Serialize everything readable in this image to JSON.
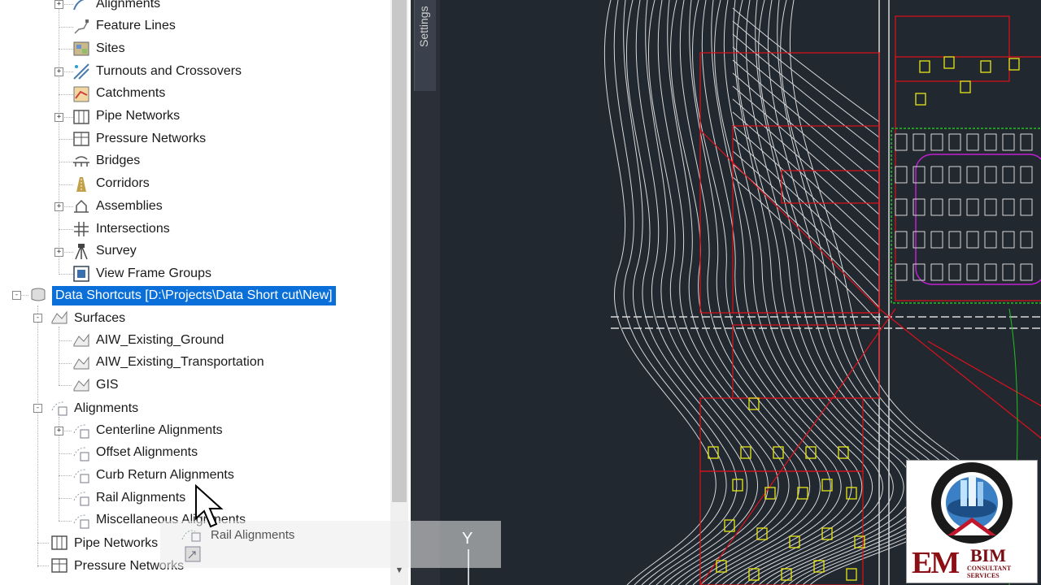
{
  "toolspace": {
    "prospector_items": [
      {
        "label": "Alignments",
        "icon": "alignments-icon",
        "expandable": true
      },
      {
        "label": "Feature Lines",
        "icon": "feature-lines-icon",
        "expandable": false
      },
      {
        "label": "Sites",
        "icon": "sites-icon",
        "expandable": false
      },
      {
        "label": "Turnouts and Crossovers",
        "icon": "turnouts-icon",
        "expandable": true
      },
      {
        "label": "Catchments",
        "icon": "catchments-icon",
        "expandable": false
      },
      {
        "label": "Pipe Networks",
        "icon": "pipe-networks-icon",
        "expandable": true
      },
      {
        "label": "Pressure Networks",
        "icon": "pressure-networks-icon",
        "expandable": false
      },
      {
        "label": "Bridges",
        "icon": "bridges-icon",
        "expandable": false
      },
      {
        "label": "Corridors",
        "icon": "corridors-icon",
        "expandable": false
      },
      {
        "label": "Assemblies",
        "icon": "assemblies-icon",
        "expandable": true
      },
      {
        "label": "Intersections",
        "icon": "intersections-icon",
        "expandable": false
      },
      {
        "label": "Survey",
        "icon": "survey-icon",
        "expandable": true
      },
      {
        "label": "View Frame Groups",
        "icon": "view-frame-groups-icon",
        "expandable": false
      }
    ],
    "data_shortcuts": {
      "label": "Data Shortcuts [D:\\Projects\\Data Short cut\\New]",
      "surfaces": {
        "label": "Surfaces",
        "items": [
          "AIW_Existing_Ground",
          "AIW_Existing_Transportation",
          "GIS"
        ]
      },
      "alignments": {
        "label": "Alignments",
        "items": [
          {
            "label": "Centerline Alignments",
            "expandable": true
          },
          {
            "label": "Offset Alignments",
            "expandable": false
          },
          {
            "label": "Curb Return Alignments",
            "expandable": false
          },
          {
            "label": "Rail Alignments",
            "expandable": false
          },
          {
            "label": "Miscellaneous Alignments",
            "expandable": false
          }
        ]
      },
      "pipe_networks": "Pipe Networks",
      "pressure_networks": "Pressure Networks"
    },
    "settings_tab": "Settings"
  },
  "drag_ghost": {
    "label": "Rail Alignments"
  },
  "canvas": {
    "ucs_axis_label": "Y"
  },
  "logo": {
    "ring_text": "DESIGN · ENGINEERING · CONSTRUCTION · SUPERVISION · TRAINING",
    "brand_letters": "EM",
    "brand_name": "BIM",
    "tagline": "CONSULTANT SERVICES"
  },
  "colors": {
    "selection": "#0a6fd8",
    "canvas_bg": "#212830",
    "contour": "#d8d8d8",
    "parcel": "#e0101a",
    "building": "#e6e61a",
    "lot": "#22c022",
    "road_edge": "#c020d0"
  }
}
